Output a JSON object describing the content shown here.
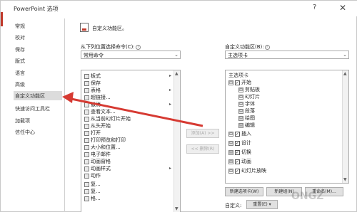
{
  "window": {
    "title": "PowerPoint 选项",
    "help": "?",
    "close": "✕"
  },
  "sidebar": {
    "items": [
      {
        "label": "常规"
      },
      {
        "label": "校对"
      },
      {
        "label": "保存"
      },
      {
        "label": "版式"
      },
      {
        "label": "语言"
      },
      {
        "label": "高级"
      },
      {
        "label": "自定义功能区",
        "selected": true
      },
      {
        "label": "快速访问工具栏"
      },
      {
        "label": "加载项"
      },
      {
        "label": "信任中心"
      }
    ]
  },
  "header": {
    "title": "自定义功能区。"
  },
  "left": {
    "choose_label": "从下列位置选择命令(C):",
    "choose_value": "常用命令",
    "commands": [
      {
        "label": "板式",
        "sub": "▸"
      },
      {
        "label": "保存"
      },
      {
        "label": "表格",
        "sub": "▸"
      },
      {
        "label": "超链接..."
      },
      {
        "label": "撤消",
        "sub": "▸"
      },
      {
        "label": "查看文本..."
      },
      {
        "label": "从当前幻灯片开始"
      },
      {
        "label": "从头开始"
      },
      {
        "label": "打开"
      },
      {
        "label": "打印预览和打印"
      },
      {
        "label": "大小和位置..."
      },
      {
        "label": "电子邮件"
      },
      {
        "label": "动画窗格"
      },
      {
        "label": "动画样式",
        "sub": "▸"
      },
      {
        "label": "动作"
      },
      {
        "label": "复..."
      },
      {
        "label": "复..."
      },
      {
        "label": "格..."
      }
    ]
  },
  "middle": {
    "add_button": "添加(A) >>",
    "remove_button": "<< 删除(R)"
  },
  "right": {
    "customize_label": "自定义功能区(B):",
    "customize_value": "主选项卡",
    "tree_header": "主选项卡",
    "tree": [
      {
        "label": "开始",
        "exp": "⊟",
        "checked": true,
        "level": 0
      },
      {
        "label": "剪贴板",
        "exp": "⊞",
        "level": 1
      },
      {
        "label": "幻灯片",
        "exp": "⊞",
        "level": 1
      },
      {
        "label": "字体",
        "exp": "⊞",
        "level": 1
      },
      {
        "label": "段落",
        "exp": "⊞",
        "level": 1
      },
      {
        "label": "绘图",
        "exp": "⊞",
        "level": 1
      },
      {
        "label": "编辑",
        "exp": "⊞",
        "level": 1
      },
      {
        "label": "插入",
        "exp": "⊞",
        "checked": true,
        "level": 0
      },
      {
        "label": "设计",
        "exp": "⊞",
        "checked": true,
        "level": 0
      },
      {
        "label": "切换",
        "exp": "⊞",
        "checked": true,
        "level": 0
      },
      {
        "label": "动画",
        "exp": "⊞",
        "checked": true,
        "level": 0
      },
      {
        "label": "幻灯片放映",
        "exp": "⊞",
        "checked": true,
        "level": 0
      }
    ],
    "new_tab_button": "新建选项卡(W)",
    "new_group_button": "新建组(N)",
    "rename_button": "重命名(M)...",
    "custom_label": "自定义:",
    "reset_button": "重置(E) ▾"
  },
  "watermark": "ONGZ"
}
